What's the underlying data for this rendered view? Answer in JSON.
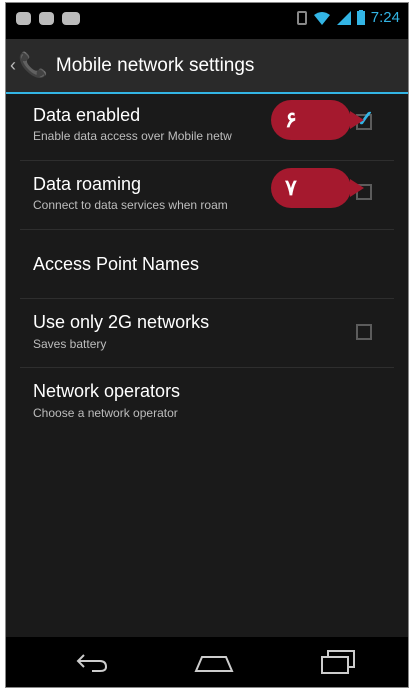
{
  "status_bar": {
    "time": "7:24"
  },
  "action_bar": {
    "title": "Mobile network settings"
  },
  "settings": [
    {
      "title": "Data enabled",
      "summary": "Enable data access over Mobile netw",
      "checked": true
    },
    {
      "title": "Data roaming",
      "summary": "Connect to data services when roam",
      "checked": false
    },
    {
      "title": "Access Point Names"
    },
    {
      "title": "Use only 2G networks",
      "summary": "Saves battery",
      "checked": false
    },
    {
      "title": "Network operators",
      "summary": "Choose a network operator"
    }
  ],
  "annotations": [
    {
      "number": "۶"
    },
    {
      "number": "۷"
    }
  ],
  "colors": {
    "accent": "#33b5e5",
    "badge": "#a5192e",
    "background": "#1a1a1a"
  },
  "nav_bar": {
    "icons": [
      "back-icon",
      "home-icon",
      "recent-apps-icon"
    ]
  }
}
